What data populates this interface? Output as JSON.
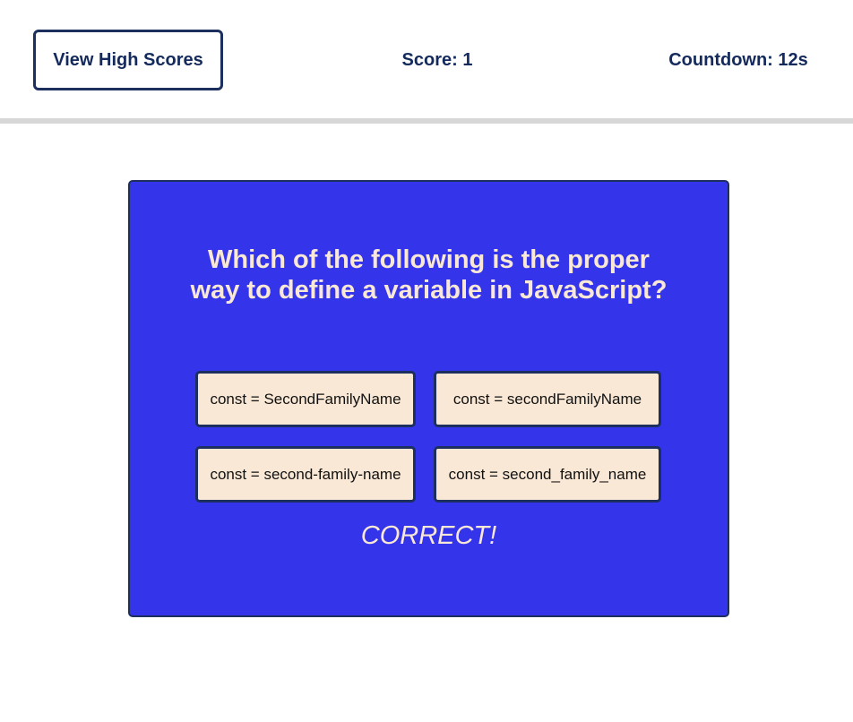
{
  "header": {
    "high_scores_label": "View High Scores",
    "score_text": "Score: 1",
    "countdown_text": "Countdown: 12s"
  },
  "quiz": {
    "question": "Which of the following is the proper way to define a variable in JavaScript?",
    "answers": [
      "const = SecondFamilyName",
      "const = secondFamilyName",
      "const = second-family-name",
      "const = second_family_name"
    ],
    "feedback": "CORRECT!"
  },
  "colors": {
    "card_background": "#3434ea",
    "card_border": "#1c2f5f",
    "answer_background": "#f9e8d5",
    "text_light": "#f9e8d6",
    "header_text": "#142a5c"
  }
}
